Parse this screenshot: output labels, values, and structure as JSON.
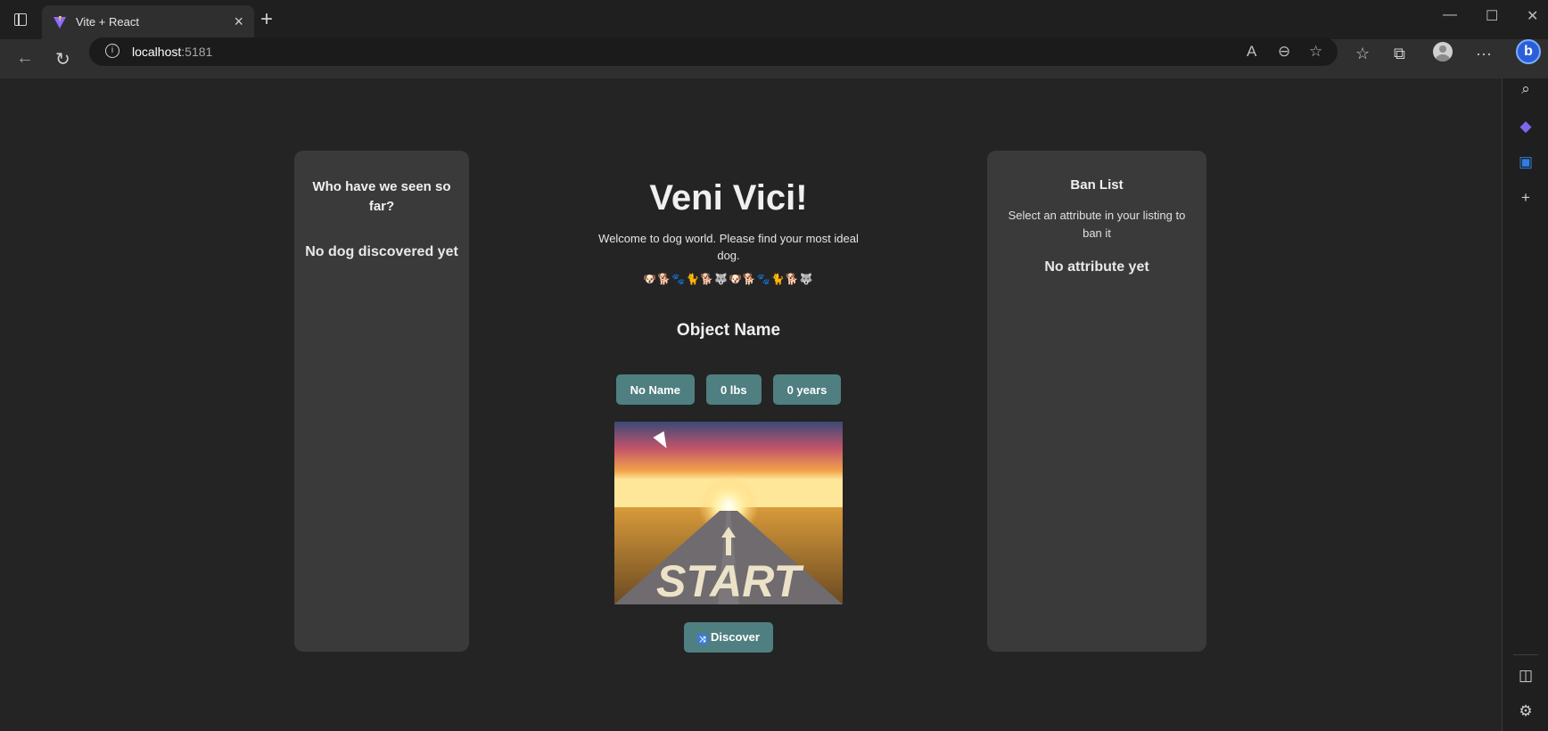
{
  "browser": {
    "tab_title": "Vite + React",
    "url_host": "localhost",
    "url_port": ":5181"
  },
  "left_panel": {
    "title": "Who have we seen so far?",
    "empty_text": "No dog discovered yet"
  },
  "main": {
    "title": "Veni Vici!",
    "welcome": "Welcome to dog world. Please find your most ideal dog.",
    "dog_emojis": "🐶🐕🐾🐈🐕🐺🐶🐕🐾🐈🐕🐺",
    "object_name": "Object Name",
    "attributes": [
      "No Name",
      "0 lbs",
      "0 years"
    ],
    "image_text": "START",
    "discover_label": "Discover"
  },
  "right_panel": {
    "title": "Ban List",
    "description": "Select an attribute in your listing to ban it",
    "empty_text": "No attribute yet"
  },
  "colors": {
    "background": "#242424",
    "panel": "#3a3a3a",
    "button": "#4f7f80"
  }
}
